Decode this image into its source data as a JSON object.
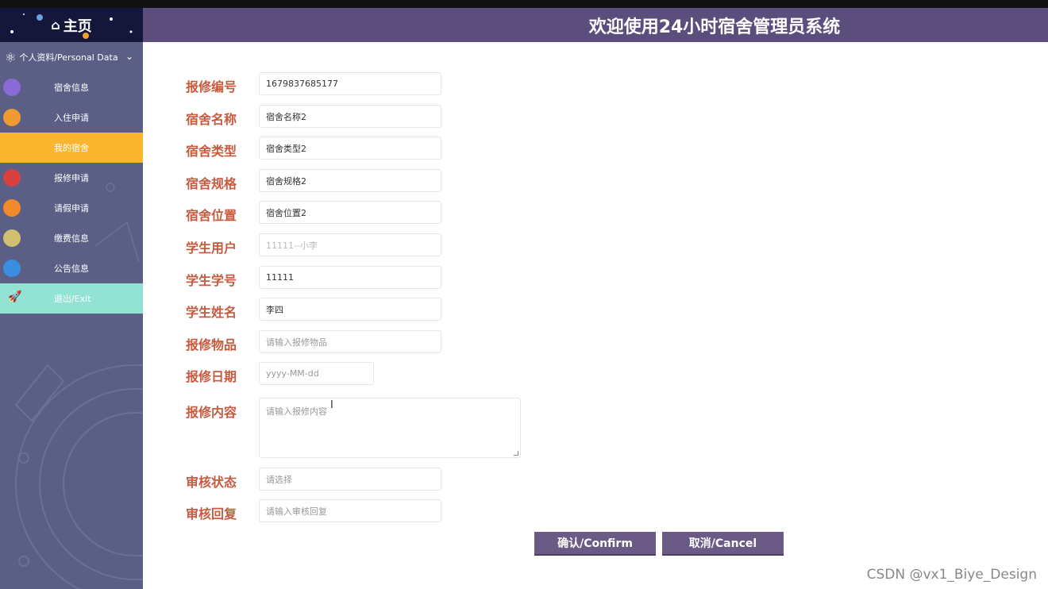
{
  "header": {
    "title": "欢迎使用24小时宿舍管理员系统"
  },
  "sidebar": {
    "home_label": "主页",
    "section_label": "个人资料/Personal Data",
    "items": [
      {
        "label": "宿舍信息",
        "planet": "#8a6ad6"
      },
      {
        "label": "入住申请",
        "planet": "#f09a32"
      },
      {
        "label": "我的宿舍",
        "planet": ""
      },
      {
        "label": "报修申请",
        "planet": "#d94040"
      },
      {
        "label": "请假申请",
        "planet": "#f08a2a"
      },
      {
        "label": "缴费信息",
        "planet": "#d0c070"
      },
      {
        "label": "公告信息",
        "planet": "#3a8ee0"
      },
      {
        "label": "退出/Exit",
        "planet": ""
      }
    ]
  },
  "form": {
    "fields": [
      {
        "label": "报修编号",
        "value": "1679837685177",
        "kind": "value"
      },
      {
        "label": "宿舍名称",
        "value": "宿舍名称2",
        "kind": "value"
      },
      {
        "label": "宿舍类型",
        "value": "宿舍类型2",
        "kind": "value"
      },
      {
        "label": "宿舍规格",
        "value": "宿舍规格2",
        "kind": "value"
      },
      {
        "label": "宿舍位置",
        "value": "宿舍位置2",
        "kind": "value"
      },
      {
        "label": "学生用户",
        "value": "11111--小李",
        "kind": "disabled"
      },
      {
        "label": "学生学号",
        "value": "11111",
        "kind": "value"
      },
      {
        "label": "学生姓名",
        "value": "李四",
        "kind": "value"
      },
      {
        "label": "报修物品",
        "value": "请输入报修物品",
        "kind": "placeholder"
      },
      {
        "label": "报修日期",
        "value": "yyyy-MM-dd",
        "kind": "placeholder"
      },
      {
        "label": "报修内容",
        "value": "请输入报修内容",
        "kind": "placeholder"
      },
      {
        "label": "审核状态",
        "value": "请选择",
        "kind": "placeholder"
      },
      {
        "label": "审核回复",
        "value": "请输入审核回复",
        "kind": "placeholder"
      }
    ],
    "confirm_label": "确认/Confirm",
    "cancel_label": "取消/Cancel"
  },
  "watermark": "CSDN @vx1_Biye_Design",
  "colors": {
    "header": "#5b4e7d",
    "sidebar": "#5b5f86",
    "active": "#fcb52f",
    "exit": "#93e3d5",
    "label": "#c75a3f",
    "button": "#6b5a85"
  }
}
